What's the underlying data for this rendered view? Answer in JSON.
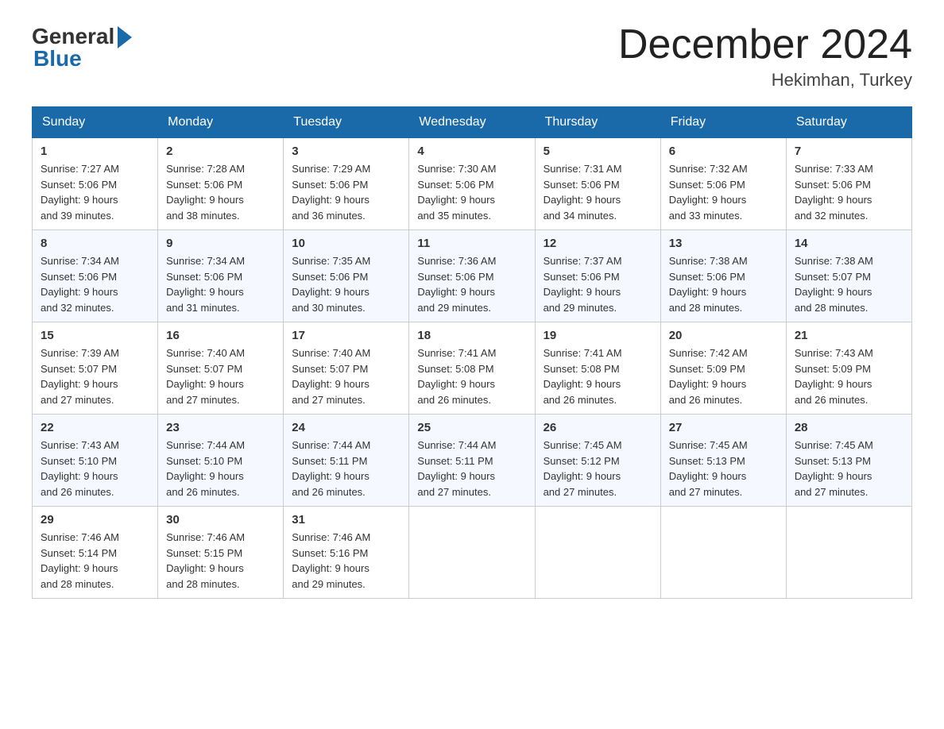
{
  "header": {
    "logo_general": "General",
    "logo_blue": "Blue",
    "month_title": "December 2024",
    "location": "Hekimhan, Turkey"
  },
  "days_of_week": [
    "Sunday",
    "Monday",
    "Tuesday",
    "Wednesday",
    "Thursday",
    "Friday",
    "Saturday"
  ],
  "weeks": [
    [
      {
        "day": "1",
        "sunrise": "7:27 AM",
        "sunset": "5:06 PM",
        "daylight": "9 hours and 39 minutes."
      },
      {
        "day": "2",
        "sunrise": "7:28 AM",
        "sunset": "5:06 PM",
        "daylight": "9 hours and 38 minutes."
      },
      {
        "day": "3",
        "sunrise": "7:29 AM",
        "sunset": "5:06 PM",
        "daylight": "9 hours and 36 minutes."
      },
      {
        "day": "4",
        "sunrise": "7:30 AM",
        "sunset": "5:06 PM",
        "daylight": "9 hours and 35 minutes."
      },
      {
        "day": "5",
        "sunrise": "7:31 AM",
        "sunset": "5:06 PM",
        "daylight": "9 hours and 34 minutes."
      },
      {
        "day": "6",
        "sunrise": "7:32 AM",
        "sunset": "5:06 PM",
        "daylight": "9 hours and 33 minutes."
      },
      {
        "day": "7",
        "sunrise": "7:33 AM",
        "sunset": "5:06 PM",
        "daylight": "9 hours and 32 minutes."
      }
    ],
    [
      {
        "day": "8",
        "sunrise": "7:34 AM",
        "sunset": "5:06 PM",
        "daylight": "9 hours and 32 minutes."
      },
      {
        "day": "9",
        "sunrise": "7:34 AM",
        "sunset": "5:06 PM",
        "daylight": "9 hours and 31 minutes."
      },
      {
        "day": "10",
        "sunrise": "7:35 AM",
        "sunset": "5:06 PM",
        "daylight": "9 hours and 30 minutes."
      },
      {
        "day": "11",
        "sunrise": "7:36 AM",
        "sunset": "5:06 PM",
        "daylight": "9 hours and 29 minutes."
      },
      {
        "day": "12",
        "sunrise": "7:37 AM",
        "sunset": "5:06 PM",
        "daylight": "9 hours and 29 minutes."
      },
      {
        "day": "13",
        "sunrise": "7:38 AM",
        "sunset": "5:06 PM",
        "daylight": "9 hours and 28 minutes."
      },
      {
        "day": "14",
        "sunrise": "7:38 AM",
        "sunset": "5:07 PM",
        "daylight": "9 hours and 28 minutes."
      }
    ],
    [
      {
        "day": "15",
        "sunrise": "7:39 AM",
        "sunset": "5:07 PM",
        "daylight": "9 hours and 27 minutes."
      },
      {
        "day": "16",
        "sunrise": "7:40 AM",
        "sunset": "5:07 PM",
        "daylight": "9 hours and 27 minutes."
      },
      {
        "day": "17",
        "sunrise": "7:40 AM",
        "sunset": "5:07 PM",
        "daylight": "9 hours and 27 minutes."
      },
      {
        "day": "18",
        "sunrise": "7:41 AM",
        "sunset": "5:08 PM",
        "daylight": "9 hours and 26 minutes."
      },
      {
        "day": "19",
        "sunrise": "7:41 AM",
        "sunset": "5:08 PM",
        "daylight": "9 hours and 26 minutes."
      },
      {
        "day": "20",
        "sunrise": "7:42 AM",
        "sunset": "5:09 PM",
        "daylight": "9 hours and 26 minutes."
      },
      {
        "day": "21",
        "sunrise": "7:43 AM",
        "sunset": "5:09 PM",
        "daylight": "9 hours and 26 minutes."
      }
    ],
    [
      {
        "day": "22",
        "sunrise": "7:43 AM",
        "sunset": "5:10 PM",
        "daylight": "9 hours and 26 minutes."
      },
      {
        "day": "23",
        "sunrise": "7:44 AM",
        "sunset": "5:10 PM",
        "daylight": "9 hours and 26 minutes."
      },
      {
        "day": "24",
        "sunrise": "7:44 AM",
        "sunset": "5:11 PM",
        "daylight": "9 hours and 26 minutes."
      },
      {
        "day": "25",
        "sunrise": "7:44 AM",
        "sunset": "5:11 PM",
        "daylight": "9 hours and 27 minutes."
      },
      {
        "day": "26",
        "sunrise": "7:45 AM",
        "sunset": "5:12 PM",
        "daylight": "9 hours and 27 minutes."
      },
      {
        "day": "27",
        "sunrise": "7:45 AM",
        "sunset": "5:13 PM",
        "daylight": "9 hours and 27 minutes."
      },
      {
        "day": "28",
        "sunrise": "7:45 AM",
        "sunset": "5:13 PM",
        "daylight": "9 hours and 27 minutes."
      }
    ],
    [
      {
        "day": "29",
        "sunrise": "7:46 AM",
        "sunset": "5:14 PM",
        "daylight": "9 hours and 28 minutes."
      },
      {
        "day": "30",
        "sunrise": "7:46 AM",
        "sunset": "5:15 PM",
        "daylight": "9 hours and 28 minutes."
      },
      {
        "day": "31",
        "sunrise": "7:46 AM",
        "sunset": "5:16 PM",
        "daylight": "9 hours and 29 minutes."
      },
      null,
      null,
      null,
      null
    ]
  ],
  "labels": {
    "sunrise": "Sunrise:",
    "sunset": "Sunset:",
    "daylight": "Daylight:"
  }
}
